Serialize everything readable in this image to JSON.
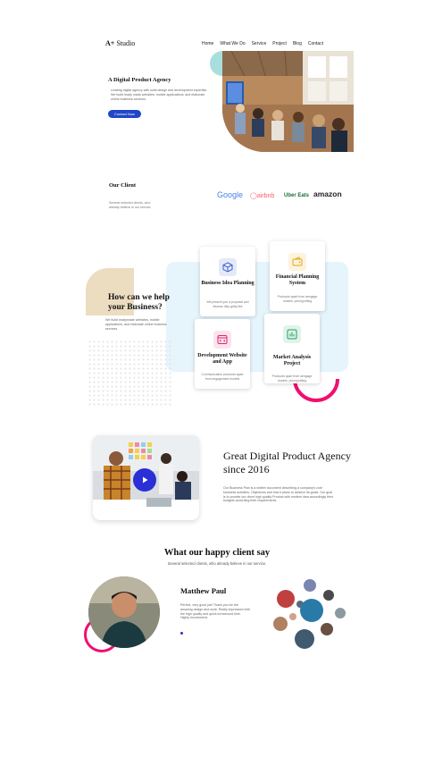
{
  "header": {
    "logo_mark": "A+",
    "logo_text": "Studio",
    "nav": [
      "Home",
      "What We Do",
      "Service",
      "Project",
      "Blog",
      "Contact"
    ]
  },
  "hero": {
    "title": "A Digital Product Agency",
    "description": "Leading digital agency with solid design and development expertise. We build ready made websites, mobile applications, and elaborate online business services.",
    "cta_label": "Contact Now"
  },
  "clients": {
    "title": "Our Client",
    "description": "Several selected clients, who already believe in our service.",
    "logos": [
      "Google",
      "airbnb",
      "Uber Eats",
      "amazon"
    ]
  },
  "services": {
    "title": "How can we help your Business?",
    "description": "We build readymade websites, mobile applications, and elaborate online business services.",
    "cards": [
      {
        "title": "Business Idea Planning",
        "description": "We present you a proposal and discuss nitty-gritty like",
        "icon": "box-icon"
      },
      {
        "title": "Financial Planning System",
        "description": "Protocols apart from aengage models, pricing billing",
        "icon": "wallet-icon"
      },
      {
        "title": "Development Website and App",
        "description": "Communication protocols apart from engagement models",
        "icon": "code-window-icon"
      },
      {
        "title": "Market Analysis Project",
        "description": "Protocols apart from aengage models, pricing billing",
        "icon": "chart-icon"
      }
    ]
  },
  "about": {
    "title": "Great Digital Product Agency since 2016",
    "description": "Our Business Plan is a written document describing a company's core business activities, Objectives and how it plans to achieve its goals. Our goal is to provide our client high quality Product with modern idea accordingly their budgets according their requirements."
  },
  "testimonials": {
    "title": "What our happy client say",
    "subtitle": "Several selected clients, who already believe in our service.",
    "name": "Matthew Paul",
    "text": "Perfect, very good job! Thank you for the amazing design and work. Really impressed with the high quality and quick turnaround time. Highly recommend."
  },
  "colors": {
    "accent_blue": "#2146c7",
    "pink": "#ef0f6f",
    "teal": "#a8dedb",
    "beige": "#ecdcc0",
    "light_blue": "#e6f4fc"
  }
}
